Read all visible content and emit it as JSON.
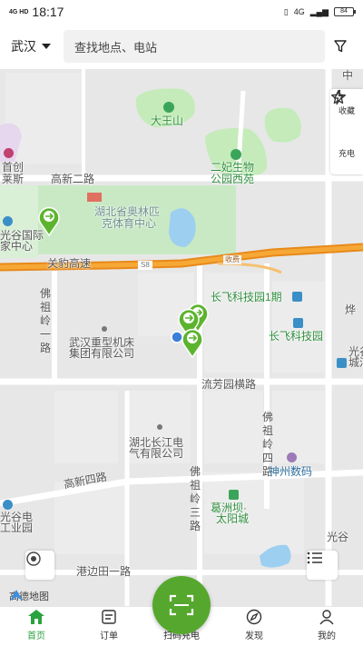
{
  "status_bar": {
    "network": "4G HD",
    "time": "18:17",
    "signal": "4G",
    "battery": "84"
  },
  "header": {
    "city": "武汉",
    "search_placeholder": "查找地点、电站"
  },
  "side_actions": [
    {
      "label": "收藏",
      "icon": "star-icon"
    },
    {
      "label": "充电",
      "icon": "lightning-icon"
    }
  ],
  "map": {
    "labels": {
      "zhong": "中",
      "dawangshan": "大王山",
      "shouchuang_1": "首创",
      "shouchuang_2": "莱斯",
      "gaoxin2": "高新二路",
      "ertong_1": "二妃生物",
      "ertong_2": "公园西苑",
      "olympic_1": "湖北省奥林匹",
      "olympic_2": "克体育中心",
      "guang_1": "光谷国际",
      "guang_2": "家中心",
      "guanbao": "关豹高速",
      "s8": "S8",
      "toll": "收费",
      "changfei1": "长飞科技园1期",
      "changfei": "长飞科技园",
      "fozu1": "佛祖岭一路",
      "heavy_1": "武汉重型机床",
      "heavy_2": "集团有限公司",
      "liufang": "流芳园横路",
      "changjiang_1": "湖北长江电",
      "changjiang_2": "气有限公司",
      "fozu4": "佛祖岭四路",
      "shenzhou": "神州数码",
      "gaoxin4": "高新四路",
      "fozu3": "佛祖岭三路",
      "gezhou_1": "葛洲坝·",
      "gezhou_2": "太阳城",
      "guanggu_dian_1": "光谷电",
      "guanggu_dian_2": "工业园",
      "gangbian": "港边田一路",
      "guang_r_1": "光谷",
      "guang_r_2": "城汇",
      "ye": "烨",
      "guang2": "光谷"
    },
    "brand": "高德地图"
  },
  "tabs": [
    {
      "label": "首页",
      "icon": "home-icon",
      "active": true
    },
    {
      "label": "订单",
      "icon": "order-icon",
      "active": false
    },
    {
      "label": "扫码充电",
      "icon": "scan-icon",
      "active": false
    },
    {
      "label": "发现",
      "icon": "discover-icon",
      "active": false
    },
    {
      "label": "我的",
      "icon": "profile-icon",
      "active": false
    }
  ],
  "colors": {
    "accent": "#2aa33e",
    "scan_button": "#55a82d",
    "highway": "#f29a20",
    "park": "#bfe8b4",
    "water": "#9ccff0"
  }
}
